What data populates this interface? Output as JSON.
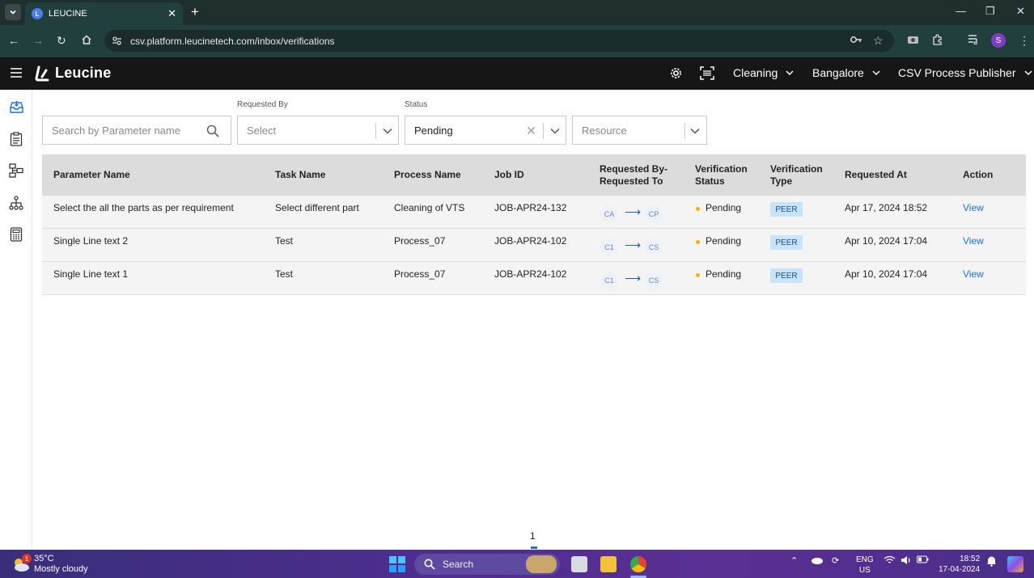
{
  "browser": {
    "tab_title": "LEUCINE",
    "url": "csv.platform.leucinetech.com/inbox/verifications",
    "profile_initial": "S"
  },
  "app": {
    "logo_text": "Leucine",
    "facility_dropdown": "Cleaning",
    "location_dropdown": "Bangalore",
    "role_dropdown": "CSV Process Publisher"
  },
  "filters": {
    "search_placeholder": "Search by Parameter name",
    "requested_by_label": "Requested By",
    "requested_by_placeholder": "Select",
    "status_label": "Status",
    "status_value": "Pending",
    "resource_placeholder": "Resource"
  },
  "table": {
    "headers": {
      "parameter_name": "Parameter Name",
      "task_name": "Task Name",
      "process_name": "Process Name",
      "job_id": "Job ID",
      "requested_by_to_1": "Requested By-",
      "requested_by_to_2": "Requested To",
      "verification_status_1": "Verification",
      "verification_status_2": "Status",
      "verification_type_1": "Verification",
      "verification_type_2": "Type",
      "requested_at": "Requested At",
      "action": "Action"
    },
    "rows": [
      {
        "parameter_name": "Select the all the parts as per requirement",
        "task_name": "Select different part",
        "process_name": "Cleaning of VTS",
        "job_id": "JOB-APR24-132",
        "requested_by": "CA",
        "requested_to": "CP",
        "status": "Pending",
        "type": "PEER",
        "requested_at": "Apr 17, 2024 18:52",
        "action": "View"
      },
      {
        "parameter_name": "Single Line text 2",
        "task_name": "Test",
        "process_name": "Process_07",
        "job_id": "JOB-APR24-102",
        "requested_by": "C1",
        "requested_to": "CS",
        "status": "Pending",
        "type": "PEER",
        "requested_at": "Apr 10, 2024 17:04",
        "action": "View"
      },
      {
        "parameter_name": "Single Line text 1",
        "task_name": "Test",
        "process_name": "Process_07",
        "job_id": "JOB-APR24-102",
        "requested_by": "C1",
        "requested_to": "CS",
        "status": "Pending",
        "type": "PEER",
        "requested_at": "Apr 10, 2024 17:04",
        "action": "View"
      }
    ]
  },
  "pagination": {
    "current_page": "1"
  },
  "taskbar": {
    "temperature": "35°C",
    "weather": "Mostly cloudy",
    "weather_badge": "1",
    "search_label": "Search",
    "language_1": "ENG",
    "language_2": "US",
    "time": "18:52",
    "date": "17-04-2024"
  },
  "colors": {
    "accent_link": "#1d6fdc",
    "pending_dot": "#f0b400",
    "peer_badge": "#c8e4fb",
    "app_header": "#161616",
    "browser_chrome": "#213f3c"
  }
}
